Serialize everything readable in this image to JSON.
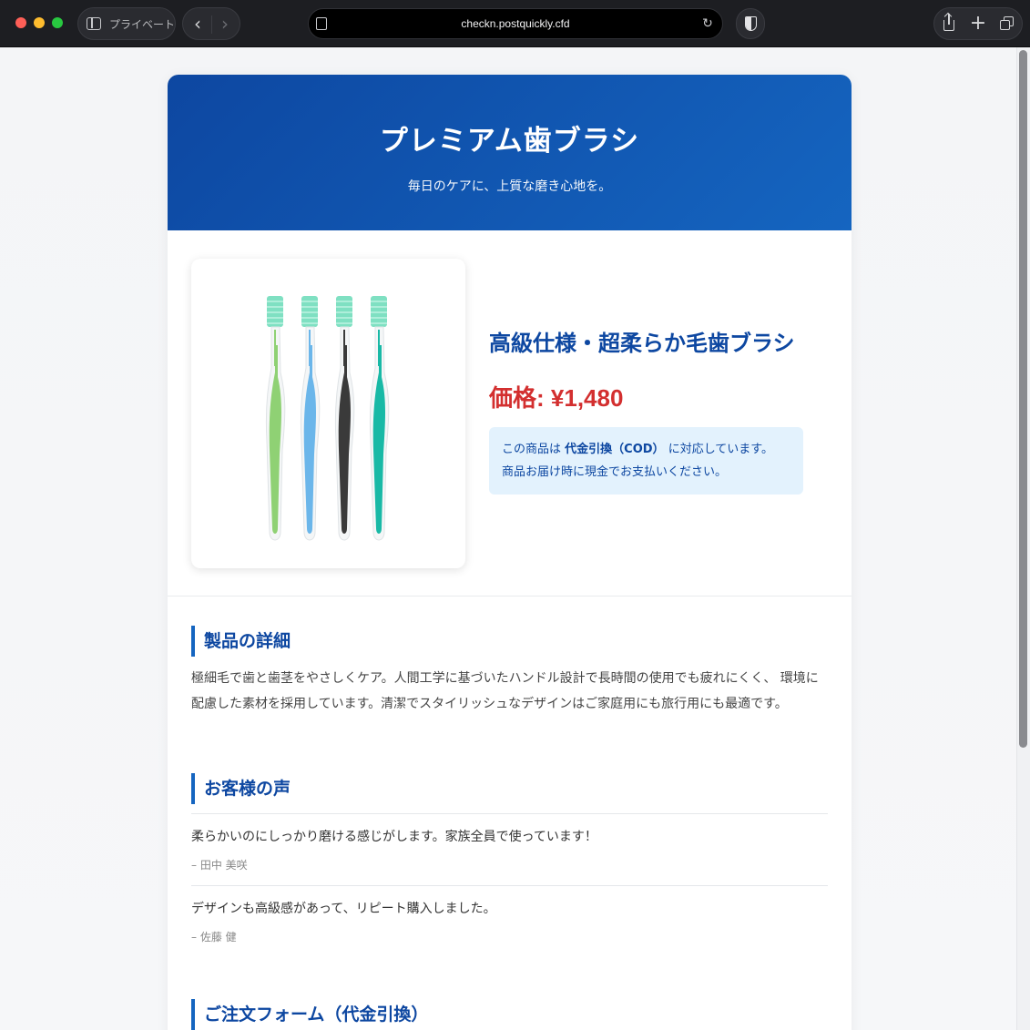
{
  "browser": {
    "private_label": "プライベート",
    "url": "checkn.postquickly.cfd"
  },
  "hero": {
    "title": "プレミアム歯ブラシ",
    "subtitle": "毎日のケアに、上質な磨き心地を。"
  },
  "product": {
    "name": "高級仕様・超柔らか毛歯ブラシ",
    "price_label": "価格:",
    "price_value": "¥1,480",
    "cod_prefix": "この商品は",
    "cod_bold": "代金引換（COD）",
    "cod_suffix": "に対応しています。",
    "cod_line2": "商品お届け時に現金でお支払いください。",
    "toothbrush_colors": [
      "#8fd174",
      "#6bb6ea",
      "#3a3a3a",
      "#19b9a6"
    ]
  },
  "details": {
    "title": "製品の詳細",
    "text": "極細毛で歯と歯茎をやさしくケア。人間工学に基づいたハンドル設計で長時間の使用でも疲れにくく、 環境に配慮した素材を採用しています。清潔でスタイリッシュなデザインはご家庭用にも旅行用にも最適です。"
  },
  "reviews": {
    "title": "お客様の声",
    "items": [
      {
        "text": "柔らかいのにしっかり磨ける感じがします。家族全員で使っています！",
        "author": "– 田中 美咲"
      },
      {
        "text": "デザインも高級感があって、リピート購入しました。",
        "author": "– 佐藤 健"
      }
    ]
  },
  "order": {
    "title": "ご注文フォーム（代金引換）"
  }
}
